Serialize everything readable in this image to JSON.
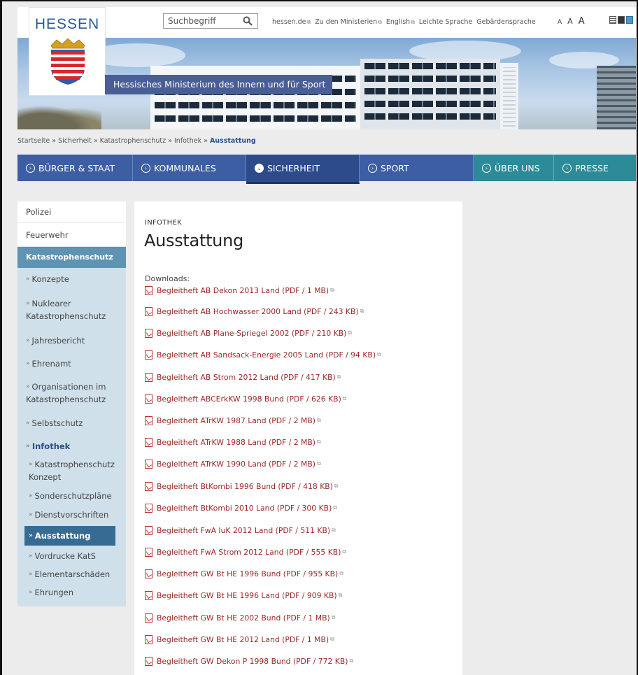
{
  "header": {
    "logo_text": "HESSEN",
    "ministry": "Hessisches Ministerium des Innern und für Sport",
    "search": {
      "placeholder": "Suchbegriff"
    },
    "top_links": [
      "hessen.de",
      "Zu den Ministerien",
      "English",
      "Leichte Sprache",
      "Gebärdensprache"
    ],
    "font_sizes": [
      "A",
      "A",
      "A"
    ]
  },
  "breadcrumb": {
    "items": [
      "Startseite",
      "Sicherheit",
      "Katastrophenschutz",
      "Infothek"
    ],
    "separator": " » ",
    "current": "Ausstattung"
  },
  "nav": {
    "items": [
      {
        "label": "BÜRGER & STAAT"
      },
      {
        "label": "KOMMUNALES"
      },
      {
        "label": "SICHERHEIT"
      },
      {
        "label": "SPORT"
      },
      {
        "label": "ÜBER UNS"
      },
      {
        "label": "PRESSE"
      }
    ]
  },
  "sidebar": {
    "items": [
      {
        "label": "Polizei"
      },
      {
        "label": "Feuerwehr"
      },
      {
        "label": "Katastrophenschutz"
      },
      {
        "label": "Konzepte"
      },
      {
        "label": "Nuklearer Katastrophenschutz"
      },
      {
        "label": "Jahresbericht"
      },
      {
        "label": "Ehrenamt"
      },
      {
        "label": "Organisationen im Katastrophenschutz"
      },
      {
        "label": "Selbstschutz"
      },
      {
        "label": "Infothek"
      },
      {
        "label": "Katastrophenschutz Konzept"
      },
      {
        "label": "Sonderschutzpläne"
      },
      {
        "label": "Dienstvorschriften"
      },
      {
        "label": "Ausstattung"
      },
      {
        "label": "Vordrucke KatS"
      },
      {
        "label": "Elementarschäden"
      },
      {
        "label": "Ehrungen"
      }
    ]
  },
  "content": {
    "kicker": "INFOTHEK",
    "title": "Ausstattung",
    "downloads_label": "Downloads:",
    "downloads": [
      "Begleitheft AB Dekon 2013 Land (PDF / 1 MB)",
      "Begleitheft AB Hochwasser 2000 Land (PDF / 243 KB)",
      "Begleitheft AB Plane-Spriegel 2002 (PDF / 210 KB)",
      "Begleitheft AB Sandsack-Energie 2005 Land (PDF / 94 KB)",
      "Begleitheft AB Strom 2012 Land (PDF / 417 KB)",
      "Begleitheft ABCErkKW 1998 Bund (PDF / 626 KB)",
      "Begleitheft ATrKW 1987 Land (PDF / 2 MB)",
      "Begleitheft ATrKW 1988 Land (PDF / 2 MB)",
      "Begleitheft ATrKW 1990 Land (PDF / 2 MB)",
      "Begleitheft BtKombi 1996 Bund (PDF / 418 KB)",
      "Begleitheft BtKombi 2010 Land (PDF / 300 KB)",
      "Begleitheft FwA IuK 2012 Land (PDF / 511 KB)",
      "Begleitheft FwA Strom 2012 Land (PDF / 555 KB)",
      "Begleitheft GW Bt HE 1996 Bund (PDF / 955 KB)",
      "Begleitheft GW Bt HE 1996 Land (PDF / 909 KB)",
      "Begleitheft GW Bt HE 2002 Bund (PDF / 1 MB)",
      "Begleitheft GW Bt HE 2012 Land (PDF / 1 MB)",
      "Begleitheft GW Dekon P 1998 Bund (PDF / 772 KB)"
    ]
  }
}
